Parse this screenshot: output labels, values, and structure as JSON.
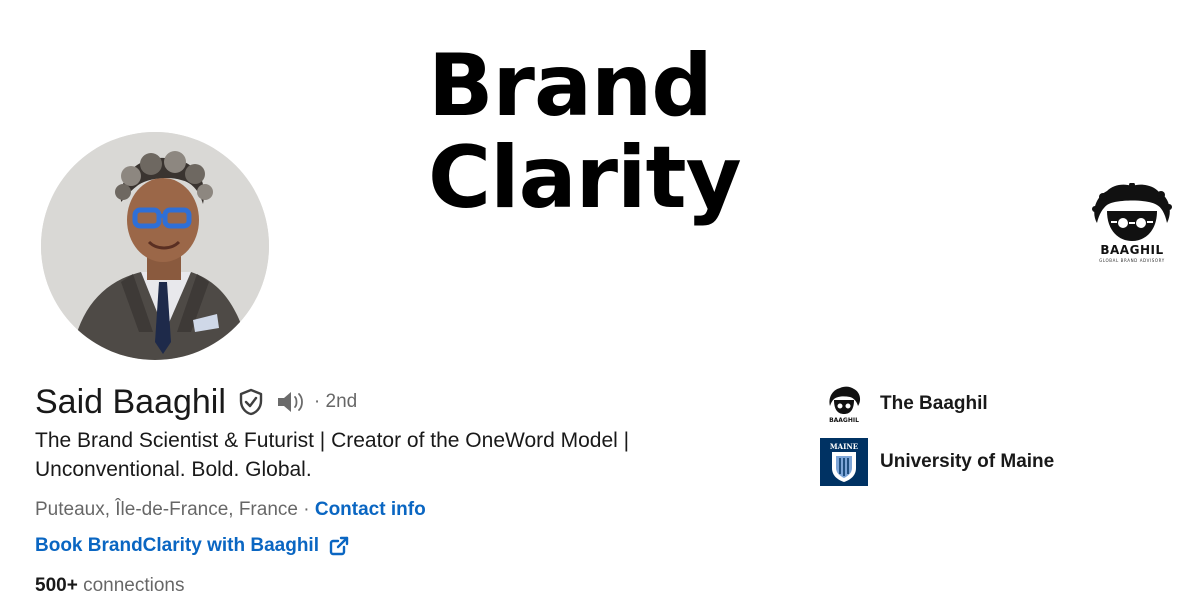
{
  "banner": {
    "title_line1": "Brand",
    "title_line2": "Clarity",
    "logo_name": "BAAGHIL",
    "logo_tagline": "GLOBAL BRAND ADVISORY"
  },
  "profile": {
    "name": "Said Baaghil",
    "degree": "· 2nd",
    "headline": "The Brand Scientist & Futurist | Creator of the OneWord Model | Unconventional. Bold. Global.",
    "location": "Puteaux, Île-de-France, France",
    "separator": "·",
    "contact_info": "Contact info",
    "website": "Book BrandClarity with Baaghil",
    "connections_count": "500+",
    "connections_label": "connections"
  },
  "organizations": [
    {
      "name": "The Baaghil",
      "logo_text": "BAAGHIL",
      "icon": "baaghil-logo"
    },
    {
      "name": "University of Maine",
      "logo_text": "MAINE",
      "icon": "university-shield"
    }
  ],
  "colors": {
    "link": "#0a66c2",
    "text": "#191919",
    "secondary_text": "#666666",
    "maine_blue": "#003263"
  }
}
